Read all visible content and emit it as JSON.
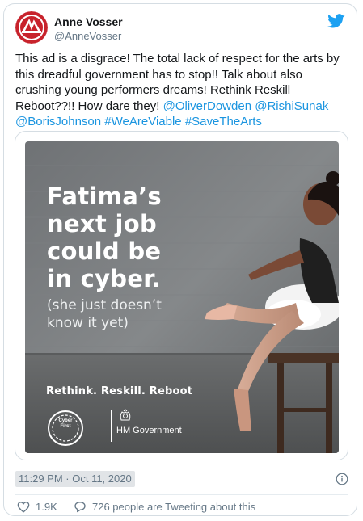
{
  "tweet": {
    "author_name": "Anne Vosser",
    "author_handle": "@AnneVosser",
    "text_plain": "This ad is a disgrace! The total lack of respect for the arts by this dreadful government has to stop!! Talk about also crushing young performers dreams! Rethink Reskill Reboot??!! How dare they! ",
    "mentions": [
      "@OliverDowden",
      "@RishiSunak",
      "@BorisJohnson"
    ],
    "hashtags": [
      "#WeAreViable",
      "#SaveTheArts"
    ],
    "timestamp": "11:29 PM · Oct 11, 2020",
    "like_count": "1.9K",
    "tweeting_about": "726 people are Tweeting about this"
  },
  "ad": {
    "headline_lines": [
      "Fatima’s",
      "next job",
      "could be",
      "in cyber."
    ],
    "subline_lines": [
      "(she just doesn’t",
      "know it yet)"
    ],
    "tagline": "Rethink. Reskill. Reboot",
    "cyber_first_lines": [
      "Cyber",
      "First"
    ],
    "hm_government": "HM Government"
  },
  "icons": {
    "brand": "twitter-bird-icon",
    "info": "info-icon",
    "like": "heart-icon",
    "comment": "speech-bubble-icon"
  },
  "colors": {
    "link": "#1b95e0",
    "twitter_blue": "#1da1f2",
    "muted": "#657786",
    "timestamp_highlight": "#e1e4e7"
  }
}
